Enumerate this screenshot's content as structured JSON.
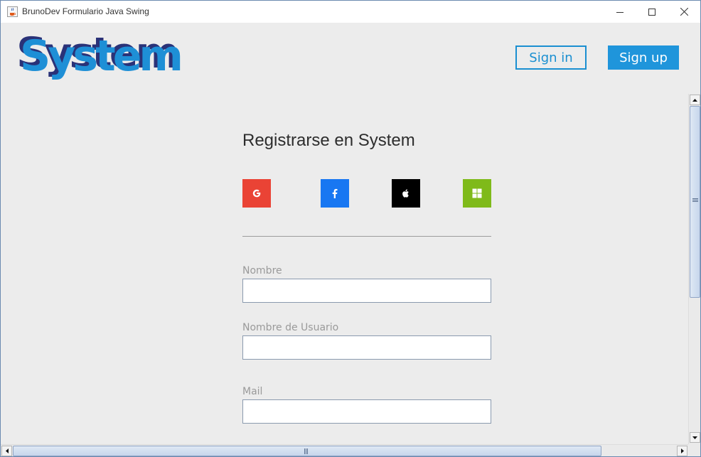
{
  "window": {
    "title": "BrunoDev Formulario Java Swing",
    "icon": "java-cup-icon",
    "controls": [
      "minimize-icon",
      "maximize-icon",
      "close-icon"
    ]
  },
  "header": {
    "logo_text": "System",
    "signin_label": "Sign in",
    "signup_label": "Sign up",
    "colors": {
      "logo_front": "#1e8fd6",
      "logo_shadow": "#2a3278",
      "accent": "#1f95db"
    }
  },
  "form": {
    "title": "Registrarse en System",
    "social_buttons": [
      {
        "name": "google-icon",
        "color": "#ea4335"
      },
      {
        "name": "facebook-icon",
        "color": "#1877f2"
      },
      {
        "name": "apple-icon",
        "color": "#000000"
      },
      {
        "name": "microsoft-icon",
        "color": "#7fba1a"
      }
    ],
    "fields": [
      {
        "label": "Nombre",
        "value": ""
      },
      {
        "label": "Nombre de Usuario",
        "value": ""
      },
      {
        "label": "Mail",
        "value": ""
      }
    ]
  }
}
